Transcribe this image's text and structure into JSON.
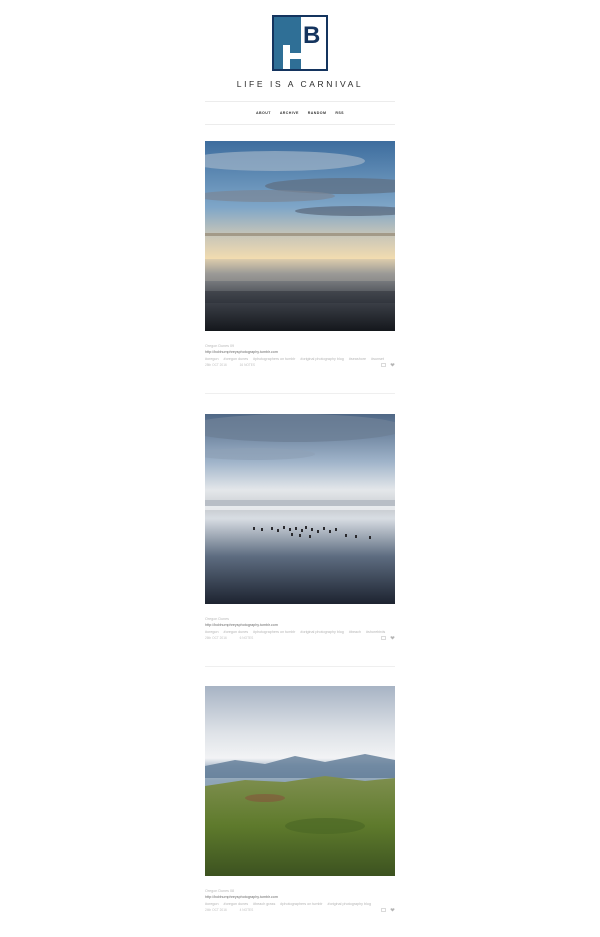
{
  "blog": {
    "title": "LIFE IS A CARNIVAL",
    "logo_text": "BH",
    "logo_color": "#2f6f96",
    "logo_dark": "#14345e"
  },
  "nav": {
    "items": [
      "ABOUT",
      "ARCHIVE",
      "RANDOM",
      "RSS"
    ]
  },
  "posts": [
    {
      "title": "Oregon Dunes 09",
      "link": "http://bobhumphreysphotography.tumblr.com",
      "tags": [
        "#oregon",
        "#oregon dunes",
        "#photographers on tumblr",
        "#original photography blog",
        "#seashore",
        "#sunset"
      ],
      "date": "28th OCT 2016",
      "notes": "16 NOTES"
    },
    {
      "title": "Oregon Dunes",
      "link": "http://bobhumphreysphotography.tumblr.com",
      "tags": [
        "#oregon",
        "#oregon dunes",
        "#photographers on tumblr",
        "#original photography blog",
        "#beach",
        "#shorebirds"
      ],
      "date": "26th OCT 2016",
      "notes": "6 NOTES"
    },
    {
      "title": "Oregon Dunes 08",
      "link": "http://bobhumphreysphotography.tumblr.com",
      "tags": [
        "#oregon",
        "#oregon dunes",
        "#beach grass",
        "#photographers on tumblr",
        "#original photography blog"
      ],
      "date": "24th OCT 2016",
      "notes": "4 NOTES"
    }
  ]
}
